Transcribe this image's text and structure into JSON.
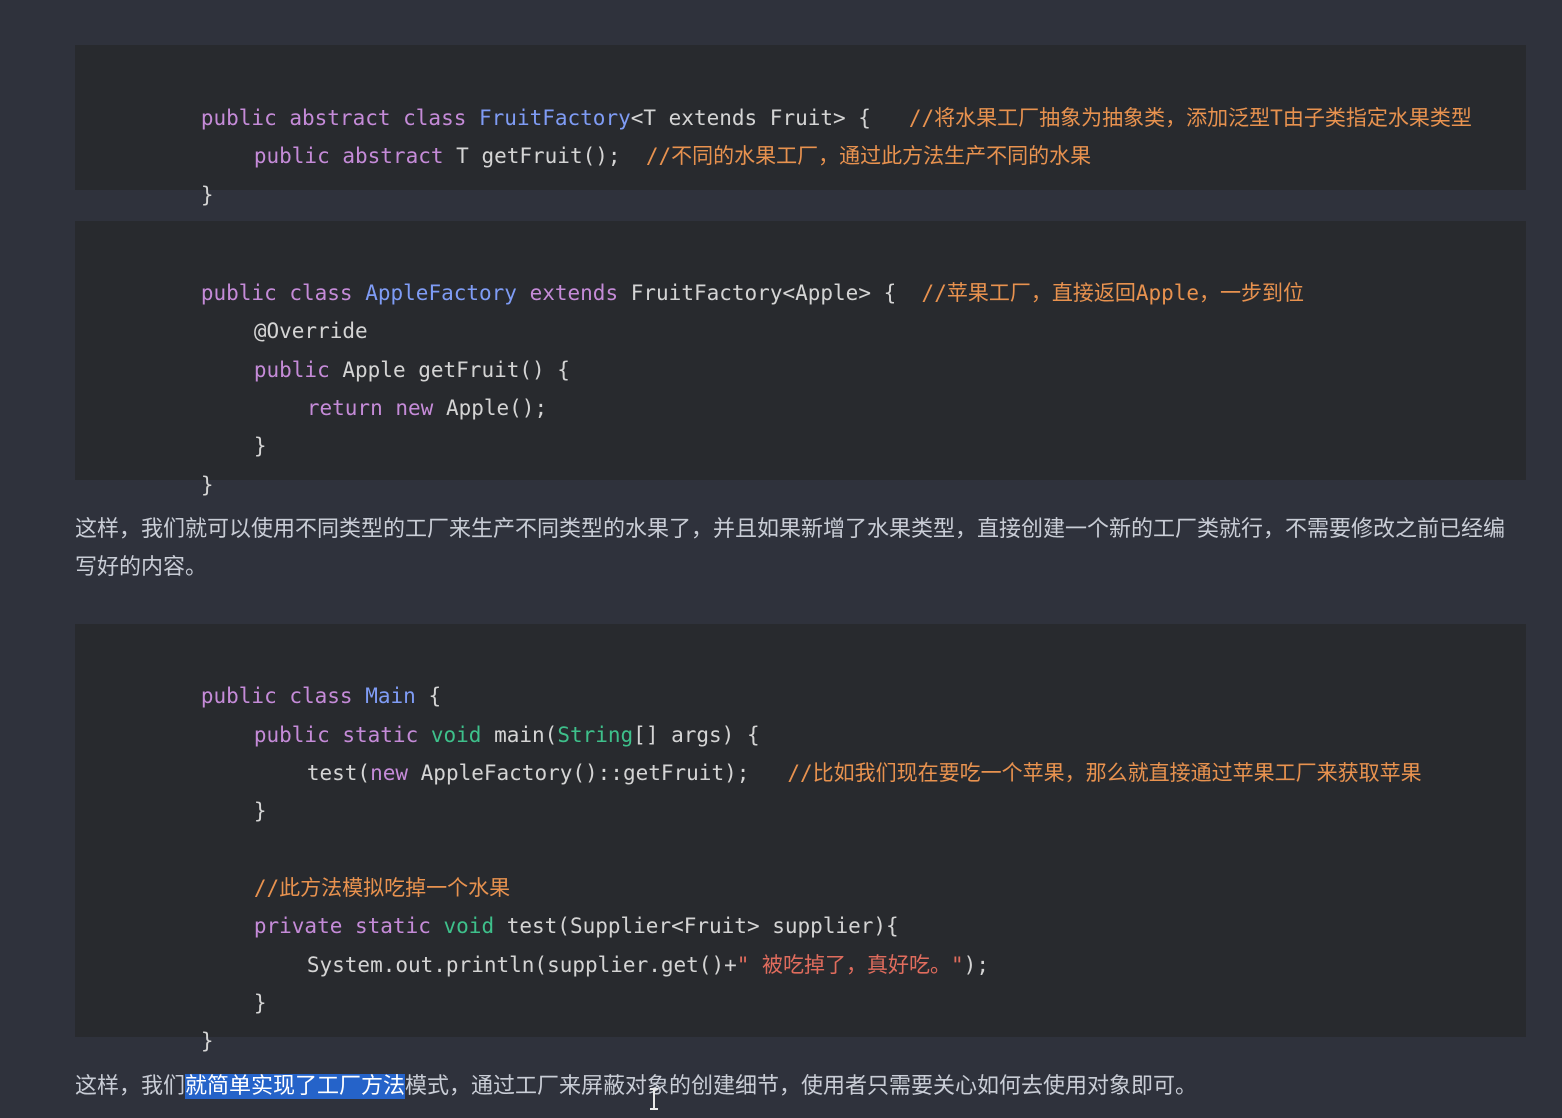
{
  "colors": {
    "background": "#2f323c",
    "code_background": "#282a2e",
    "keyword": "#c58bd8",
    "class_name": "#7f9cf5",
    "builtin_type": "#3ec08b",
    "comment": "#e8924f",
    "string": "#e06c5d",
    "selection": "#2563c9"
  },
  "code_block_1": {
    "line1": {
      "kw": "public abstract class ",
      "cls": "FruitFactory",
      "rest": "<T extends Fruit> {   ",
      "comment": "//将水果工厂抽象为抽象类，添加泛型T由子类指定水果类型"
    },
    "line2": {
      "kw": "public abstract ",
      "rest": "T getFruit();  ",
      "comment": "//不同的水果工厂，通过此方法生产不同的水果"
    },
    "line3": "}"
  },
  "code_block_2": {
    "line1": {
      "kw": "public class ",
      "cls": "AppleFactory",
      "kw2": " extends ",
      "rest": "FruitFactory<Apple> {  ",
      "comment": "//苹果工厂，直接返回Apple，一步到位"
    },
    "line2": "@Override",
    "line3": {
      "kw": "public ",
      "rest": "Apple getFruit() {"
    },
    "line4": {
      "kw": "return new ",
      "rest": "Apple();"
    },
    "line5": "}",
    "line6": "}"
  },
  "paragraph_1": "这样，我们就可以使用不同类型的工厂来生产不同类型的水果了，并且如果新增了水果类型，直接创建一个新的工厂类就行，不需要修改之前已经编写好的内容。",
  "code_block_3": {
    "line1": {
      "kw": "public class ",
      "cls": "Main",
      "rest": " {"
    },
    "line2": {
      "kw": "public static ",
      "type": "void",
      "rest1": " main(",
      "type2": "String",
      "rest2": "[] args) {"
    },
    "line3": {
      "pre": "test(",
      "kw": "new",
      "rest": " AppleFactory()::getFruit);   ",
      "comment": "//比如我们现在要吃一个苹果，那么就直接通过苹果工厂来获取苹果"
    },
    "line4": "}",
    "line5": "",
    "line6": "//此方法模拟吃掉一个水果",
    "line7": {
      "kw": "private static ",
      "type": "void",
      "rest": " test(Supplier<Fruit> supplier){"
    },
    "line8": {
      "pre": "System.out.println(supplier.get()+",
      "str": "\" 被吃掉了，真好吃。\"",
      "rest": ");"
    },
    "line9": "}",
    "line10": "}"
  },
  "paragraph_2": {
    "before": "这样，我们",
    "highlighted": "就简单实现了工厂方法",
    "after": "模式，通过工厂来屏蔽对象的创建细节，使用者只需要关心如何去使用对象即可。"
  },
  "cursor_icon": "text-cursor-icon"
}
